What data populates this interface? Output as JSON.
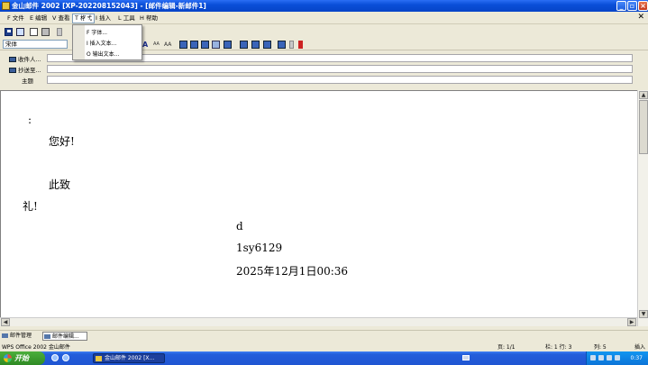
{
  "window": {
    "title": "金山邮件 2002 [XP-202208152043] - [邮件编辑-新邮件1]"
  },
  "menu": {
    "items": [
      "F 文件",
      "E 编辑",
      "V 查看",
      "T 格式",
      "I 插入",
      "L 工具",
      "H 帮助"
    ],
    "active_index": 3
  },
  "dropdown": {
    "items": [
      "F 字体...",
      "I 插入文本...",
      "O 输出文本..."
    ]
  },
  "toolbar": {
    "font_name": "宋体",
    "font_size_small": "AA",
    "font_size_large": "AA"
  },
  "address": {
    "to_label": "收件人",
    "cc_label": "抄送至",
    "subject_label": "主题",
    "to_value": "",
    "cc_value": "",
    "subject_value": ""
  },
  "body": {
    "lines": [
      ":",
      "您好!",
      "此致",
      "礼!",
      "d",
      "1sy6129",
      "2025年12月1日00:36"
    ]
  },
  "tabs": {
    "mail_manage": "邮件管理",
    "mail_edit": "邮件编辑..."
  },
  "status": {
    "app": "WPS Office 2002 金山邮件",
    "page": "页: 1/1",
    "line": "栏: 1  行: 3",
    "col": "列: 5",
    "mode": "插入"
  },
  "taskbar": {
    "start": "开始",
    "task": "金山邮件 2002 [X...",
    "clock": "0:37"
  },
  "colors": {
    "titlebar": "#0a4fd8",
    "chrome": "#ECE9D8",
    "taskbar": "#245edb",
    "start_green": "#3c9a2c"
  }
}
